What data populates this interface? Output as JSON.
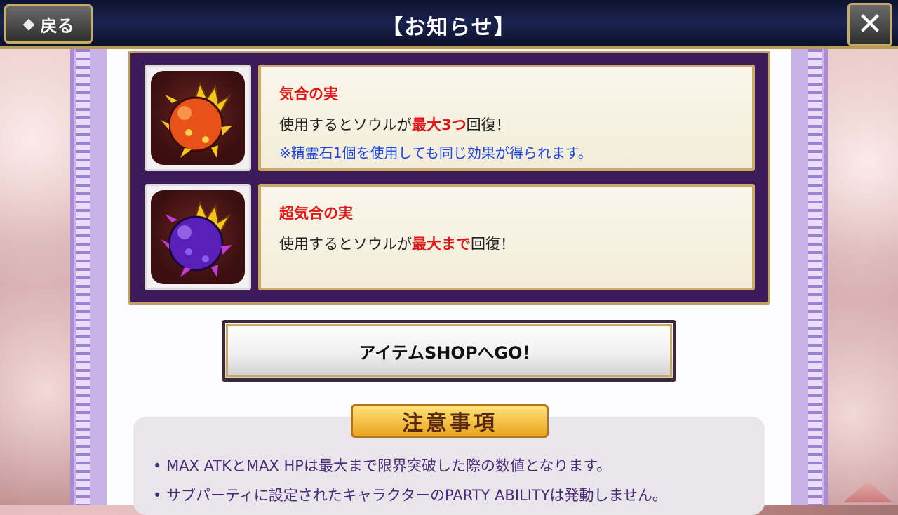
{
  "header": {
    "back_label": "戻る",
    "title": "【お知らせ】",
    "close_label": "✕"
  },
  "items": [
    {
      "name": "気合の実",
      "line_prefix": "使用するとソウルが",
      "line_highlight": "最大3つ",
      "line_suffix": "回復！",
      "note": "※精霊石1個を使用しても同じ効果が得られます。",
      "icon": "orange-spiked-fruit-icon",
      "fruit_color": "#e8521a"
    },
    {
      "name": "超気合の実",
      "line_prefix": "使用するとソウルが",
      "line_highlight": "最大まで",
      "line_suffix": "回復！",
      "note": "",
      "icon": "purple-spiked-fruit-icon",
      "fruit_color": "#5a1fb8"
    }
  ],
  "shop_button": {
    "label": "アイテムSHOPへGO！"
  },
  "notes": {
    "heading": "注意事項",
    "items": [
      "MAX ATKとMAX HPは最大まで限界突破した際の数値となります。",
      "サブパーティに設定されたキャラクターのPARTY ABILITYは発動しません。"
    ]
  },
  "colors": {
    "highlight_red": "#e01818",
    "note_blue": "#1c47e0",
    "panel_purple": "#3d1b5a",
    "gold_border": "#c9ab66"
  }
}
